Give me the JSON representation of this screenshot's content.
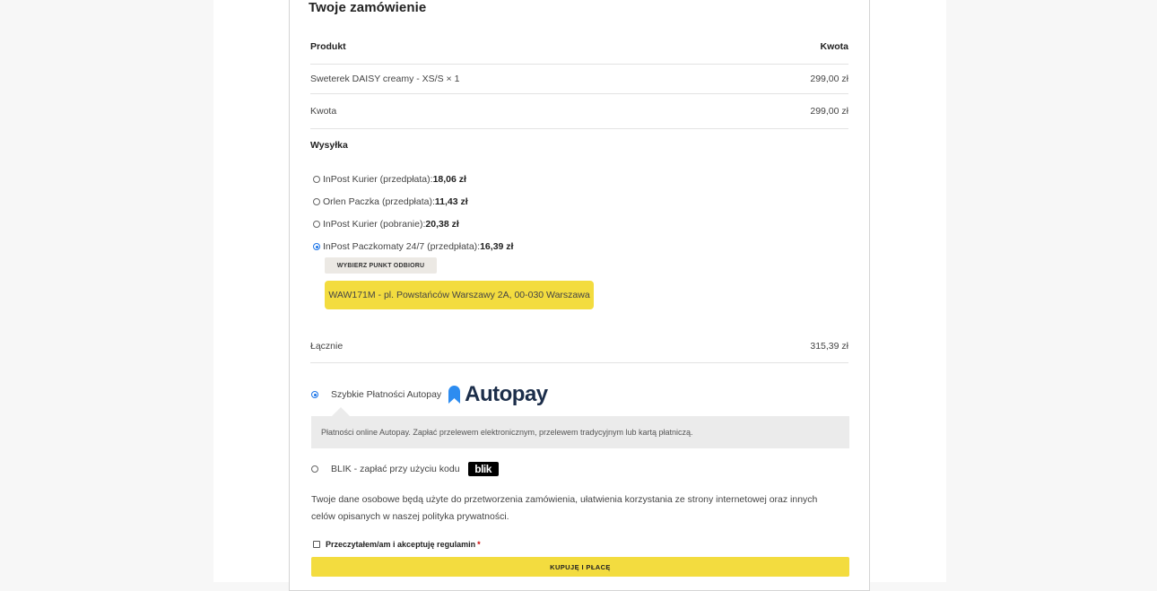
{
  "order": {
    "title": "Twoje zamówienie",
    "col_product": "Produkt",
    "col_amount": "Kwota",
    "item": {
      "name": "Sweterek DAISY creamy - XS/S × 1",
      "price": "299,00 zł"
    },
    "subtotal": {
      "label": "Kwota",
      "value": "299,00 zł"
    }
  },
  "shipping": {
    "label": "Wysyłka",
    "options": [
      {
        "label": "InPost Kurier (przedpłata): ",
        "price": "18,06 zł",
        "selected": false
      },
      {
        "label": "Orlen Paczka (przedpłata): ",
        "price": "11,43 zł",
        "selected": false
      },
      {
        "label": "InPost Kurier (pobranie): ",
        "price": "20,38 zł",
        "selected": false
      },
      {
        "label": "InPost Paczkomaty 24/7 (przedpłata): ",
        "price": "16,39 zł",
        "selected": true
      }
    ],
    "pick_point_button": "WYBIERZ PUNKT ODBIORU",
    "selected_point": "WAW171M - pl. Powstańców Warszawy 2A, 00-030 Warszawa"
  },
  "total": {
    "label": "Łącznie",
    "value": "315,39 zł"
  },
  "payment": {
    "autopay": {
      "label": "Szybkie Płatności Autopay",
      "logo_text": "Autopay",
      "selected": true,
      "description": "Płatności online Autopay. Zapłać przelewem elektronicznym, przelewem tradycyjnym lub kartą płatniczą."
    },
    "blik": {
      "label": "BLIK - zapłać przy użyciu kodu",
      "logo_text": "blik",
      "selected": false
    }
  },
  "privacy": {
    "line1": "Twoje dane osobowe będą użyte do przetworzenia zamówienia, ułatwienia korzystania ze strony internetowej oraz innych",
    "line2": "celów opisanych w naszej polityka prywatności."
  },
  "terms": {
    "label": "Przeczytałem/am i akceptuję regulamin",
    "required_mark": "*"
  },
  "buy_button": "KUPUJĘ I PŁACĘ",
  "colors": {
    "accent_yellow": "#f3dc3f",
    "radio_blue": "#1a73e8",
    "autopay_navy": "#1c2e4a",
    "autopay_icon": "#2d8cf0"
  }
}
